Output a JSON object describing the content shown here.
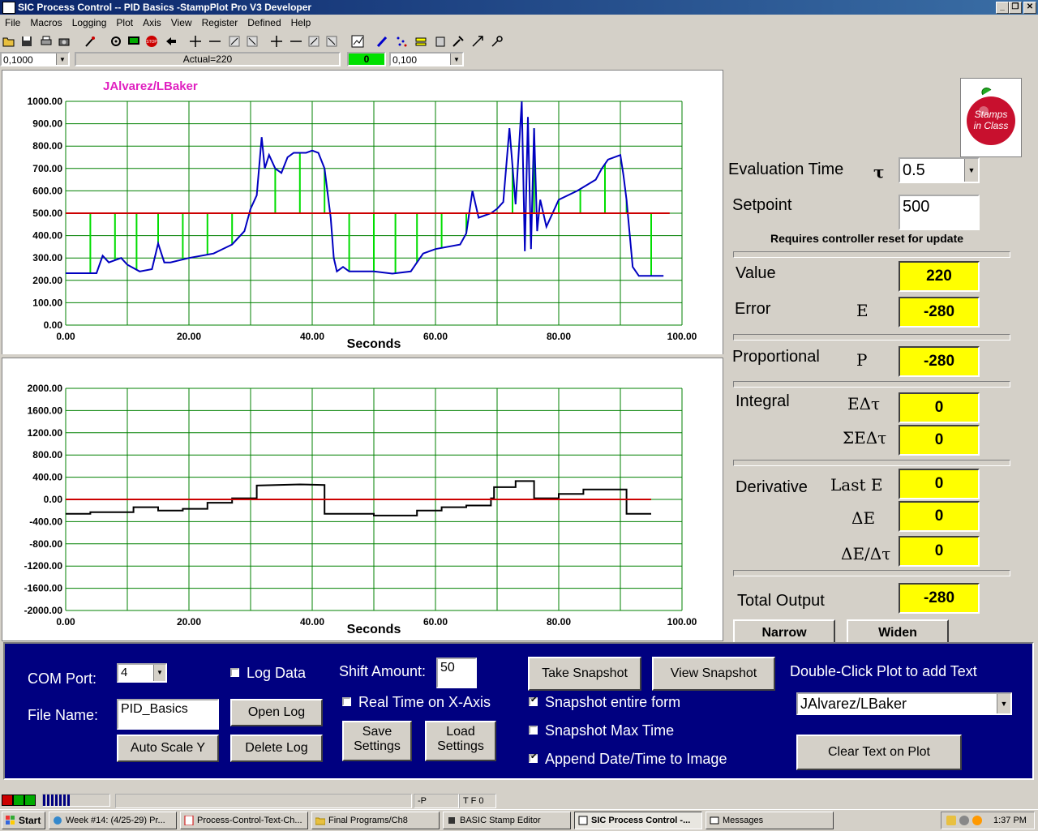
{
  "window": {
    "title": "SIC Process Control -- PID Basics -StampPlot Pro V3 Developer",
    "min": "_",
    "max": "❐",
    "close": "✕"
  },
  "menu": [
    "File",
    "Macros",
    "Logging",
    "Plot",
    "Axis",
    "View",
    "Register",
    "Defined",
    "Help"
  ],
  "toolbar_row": {
    "left_combo": "0,1000",
    "status_text": "Actual=220",
    "green_value": "0",
    "right_combo": "0,100"
  },
  "top_plot": {
    "annotation": "JAlvarez/LBaker",
    "xlabel": "Seconds",
    "yticks": [
      "1000.00",
      "900.00",
      "800.00",
      "700.00",
      "600.00",
      "500.00",
      "400.00",
      "300.00",
      "200.00",
      "100.00",
      "0.00"
    ],
    "xticks": [
      "0.00",
      "20.00",
      "40.00",
      "60.00",
      "80.00",
      "100.00"
    ]
  },
  "bottom_plot": {
    "xlabel": "Seconds",
    "yticks": [
      "2000.00",
      "1600.00",
      "1200.00",
      "800.00",
      "400.00",
      "0.00",
      "-400.00",
      "-800.00",
      "-1200.00",
      "-1600.00",
      "-2000.00"
    ],
    "xticks": [
      "0.00",
      "20.00",
      "40.00",
      "60.00",
      "80.00",
      "100.00"
    ]
  },
  "chart_data": [
    {
      "type": "line",
      "xlabel": "Seconds",
      "ylabel": "",
      "xlim": [
        0,
        100
      ],
      "ylim": [
        0,
        1000
      ],
      "grid": true,
      "series": [
        {
          "name": "",
          "color": "#0000c0",
          "points": [
            [
              0,
              232
            ],
            [
              5,
              232
            ],
            [
              6,
              310
            ],
            [
              7,
              280
            ],
            [
              9,
              300
            ],
            [
              10,
              270
            ],
            [
              12,
              240
            ],
            [
              14,
              250
            ],
            [
              15,
              365
            ],
            [
              16,
              280
            ],
            [
              17,
              280
            ],
            [
              20,
              300
            ],
            [
              24,
              320
            ],
            [
              27,
              360
            ],
            [
              29,
              420
            ],
            [
              30,
              520
            ],
            [
              31,
              580
            ],
            [
              31.8,
              840
            ],
            [
              32.3,
              700
            ],
            [
              33,
              760
            ],
            [
              34,
              700
            ],
            [
              35,
              680
            ],
            [
              36,
              750
            ],
            [
              37,
              770
            ],
            [
              39,
              770
            ],
            [
              40,
              780
            ],
            [
              41,
              770
            ],
            [
              42,
              700
            ],
            [
              43,
              480
            ],
            [
              43.5,
              300
            ],
            [
              44,
              240
            ],
            [
              45,
              260
            ],
            [
              46,
              240
            ],
            [
              50,
              240
            ],
            [
              53,
              230
            ],
            [
              56,
              240
            ],
            [
              57,
              280
            ],
            [
              58,
              320
            ],
            [
              60,
              340
            ],
            [
              64,
              360
            ],
            [
              65,
              410
            ],
            [
              66,
              600
            ],
            [
              67,
              480
            ],
            [
              69,
              500
            ],
            [
              70,
              520
            ],
            [
              71,
              550
            ],
            [
              72,
              880
            ],
            [
              73,
              540
            ],
            [
              74,
              1000
            ],
            [
              74.5,
              330
            ],
            [
              75,
              930
            ],
            [
              75.5,
              340
            ],
            [
              76,
              880
            ],
            [
              76.5,
              420
            ],
            [
              77,
              560
            ],
            [
              78,
              440
            ],
            [
              80,
              560
            ],
            [
              83,
              600
            ],
            [
              86,
              650
            ],
            [
              87,
              700
            ],
            [
              88,
              740
            ],
            [
              90,
              760
            ],
            [
              90.5,
              670
            ],
            [
              91,
              560
            ],
            [
              92,
              260
            ],
            [
              93,
              220
            ],
            [
              97,
              220
            ]
          ]
        },
        {
          "name": "",
          "color": "#cc0000",
          "points": [
            [
              0,
              500
            ],
            [
              98,
              500
            ]
          ]
        }
      ],
      "error_bars_x": [
        4,
        8,
        11.5,
        15,
        19,
        23,
        27,
        34,
        38,
        42,
        46,
        50,
        53.5,
        57,
        61,
        65,
        69,
        72.5,
        76,
        80,
        83.5,
        87.5,
        91,
        95
      ]
    },
    {
      "type": "line",
      "xlabel": "Seconds",
      "ylabel": "",
      "xlim": [
        0,
        100
      ],
      "ylim": [
        -2000,
        2000
      ],
      "grid": true,
      "series": [
        {
          "name": "",
          "color": "#000000",
          "points": [
            [
              0,
              -260
            ],
            [
              4,
              -260
            ],
            [
              4,
              -230
            ],
            [
              11,
              -230
            ],
            [
              11,
              -140
            ],
            [
              15,
              -140
            ],
            [
              15,
              -200
            ],
            [
              19,
              -200
            ],
            [
              19,
              -170
            ],
            [
              23,
              -170
            ],
            [
              23,
              -60
            ],
            [
              27,
              -60
            ],
            [
              27,
              20
            ],
            [
              31,
              20
            ],
            [
              31,
              250
            ],
            [
              38,
              270
            ],
            [
              42,
              260
            ],
            [
              42,
              -260
            ],
            [
              50,
              -260
            ],
            [
              50,
              -290
            ],
            [
              57,
              -290
            ],
            [
              57,
              -200
            ],
            [
              61,
              -200
            ],
            [
              61,
              -140
            ],
            [
              65,
              -140
            ],
            [
              65,
              -110
            ],
            [
              69,
              -110
            ],
            [
              69,
              20
            ],
            [
              69.5,
              20
            ],
            [
              69.5,
              220
            ],
            [
              73,
              220
            ],
            [
              73,
              330
            ],
            [
              76,
              330
            ],
            [
              76,
              20
            ],
            [
              80,
              20
            ],
            [
              80,
              100
            ],
            [
              84,
              100
            ],
            [
              84,
              180
            ],
            [
              91,
              180
            ],
            [
              91,
              -260
            ],
            [
              95,
              -260
            ]
          ]
        },
        {
          "name": "",
          "color": "#cc0000",
          "points": [
            [
              0,
              0
            ],
            [
              95,
              0
            ]
          ]
        }
      ]
    }
  ],
  "right_panel": {
    "eval_time_label": "Evaluation Time",
    "tau": "τ",
    "eval_time_value": "0.5",
    "setpoint_label": "Setpoint",
    "setpoint_value": "500",
    "reset_note": "Requires controller reset for update",
    "value_label": "Value",
    "value": "220",
    "error_label": "Error",
    "error_sym": "E",
    "error_value": "-280",
    "prop_label": "Proportional",
    "prop_sym": "P",
    "prop_value": "-280",
    "integral_label": "Integral",
    "edt_sym": "EΔτ",
    "edt_value": "0",
    "sedt_sym": "ΣEΔτ",
    "sedt_value": "0",
    "deriv_label": "Derivative",
    "laste_sym": "Last E",
    "laste_value": "0",
    "de_sym": "ΔE",
    "de_value": "0",
    "dedt_sym": "ΔE/Δτ",
    "dedt_value": "0",
    "total_label": "Total Output",
    "total_value": "-280",
    "narrow": "Narrow",
    "widen": "Widen",
    "logo_text": "Stamps in Class"
  },
  "bottom_panel": {
    "com_label": "COM Port:",
    "com_value": "4",
    "file_label": "File Name:",
    "file_value": "PID_Basics",
    "log_data": "Log Data",
    "open_log": "Open Log",
    "auto_scale": "Auto Scale Y",
    "delete_log": "Delete Log",
    "shift_label": "Shift Amount:",
    "shift_value": "50",
    "realtime": "Real Time on X-Axis",
    "save_settings_1": "Save",
    "save_settings_2": "Settings",
    "load_settings_1": "Load",
    "load_settings_2": "Settings",
    "take_snapshot": "Take Snapshot",
    "view_snapshot": "View Snapshot",
    "snap_entire": "Snapshot entire form",
    "snap_max": "Snapshot Max Time",
    "append_date": "Append Date/Time to Image",
    "dbl_click": "Double-Click Plot to add Text",
    "text_combo": "JAlvarez/LBaker",
    "clear_text": "Clear Text on Plot"
  },
  "statusbar": {
    "p": "-P",
    "tf": "T F 0"
  },
  "taskbar": {
    "start": "Start",
    "tasks": [
      "Week #14: (4/25-29) Pr...",
      "Process-Control-Text-Ch...",
      "Final Programs/Ch8",
      "BASIC Stamp Editor",
      "SIC Process Control -...",
      "Messages"
    ],
    "clock": "1:37 PM"
  }
}
